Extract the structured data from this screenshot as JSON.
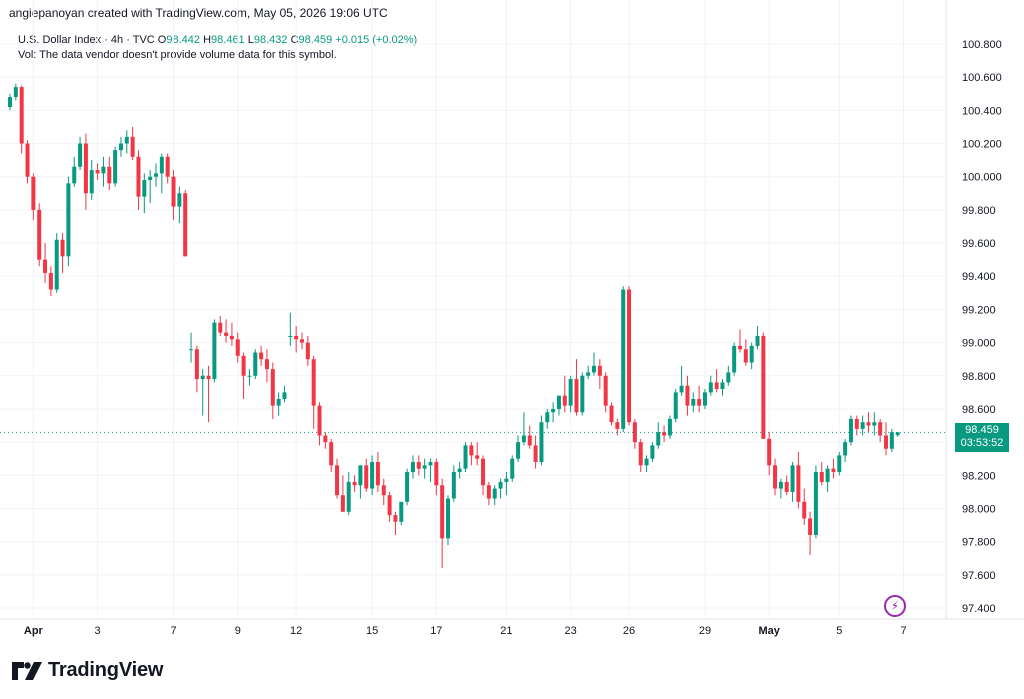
{
  "credit": "angiepanoyan created with TradingView.com, May 05, 2026 19:06 UTC",
  "legend": {
    "symbol": "U.S. Dollar Index · 4h · TVC",
    "o_label": "O",
    "o_value": "98.442",
    "h_label": "H",
    "h_value": "98.461",
    "l_label": "L",
    "l_value": "98.432",
    "c_label": "C",
    "c_value": "98.459",
    "change": "+0.015 (+0.02%)",
    "volume_note": "Vol: The data vendor doesn't provide volume data for this symbol."
  },
  "price_tag": {
    "price": "98.459",
    "countdown": "03:53:52"
  },
  "footer": {
    "logo_text": "TradingView"
  },
  "colors": {
    "up": "#089981",
    "down": "#f23645",
    "grid": "#f0f3fa",
    "text": "#131722",
    "accent_flash": "#9c27b0"
  },
  "icons": {
    "logo": "tradingview-logo-icon",
    "flash": "lightning-icon"
  },
  "chart_data": {
    "type": "candlestick",
    "ylim": [
      97.35,
      100.9
    ],
    "y_ticks": [
      "100.800",
      "100.600",
      "100.400",
      "100.200",
      "100.000",
      "99.800",
      "99.600",
      "99.400",
      "99.200",
      "99.000",
      "98.800",
      "98.600",
      "98.400",
      "98.200",
      "98.000",
      "97.800",
      "97.600",
      "97.400"
    ],
    "x_ticks": [
      {
        "label": "Apr",
        "bar": 4
      },
      {
        "label": "3",
        "bar": 15
      },
      {
        "label": "7",
        "bar": 28
      },
      {
        "label": "9",
        "bar": 39
      },
      {
        "label": "12",
        "bar": 49
      },
      {
        "label": "15",
        "bar": 62
      },
      {
        "label": "17",
        "bar": 73
      },
      {
        "label": "21",
        "bar": 85
      },
      {
        "label": "23",
        "bar": 96
      },
      {
        "label": "26",
        "bar": 106
      },
      {
        "label": "29",
        "bar": 119
      },
      {
        "label": "May",
        "bar": 130
      },
      {
        "label": "5",
        "bar": 142
      },
      {
        "label": "7",
        "bar": 153
      }
    ],
    "last_price": 98.459,
    "candles": [
      [
        100.42,
        100.5,
        100.4,
        100.48
      ],
      [
        100.48,
        100.56,
        100.46,
        100.54
      ],
      [
        100.54,
        100.55,
        100.14,
        100.2
      ],
      [
        100.2,
        100.22,
        99.96,
        100.0
      ],
      [
        100.0,
        100.02,
        99.74,
        99.8
      ],
      [
        99.8,
        99.84,
        99.46,
        99.5
      ],
      [
        99.5,
        99.6,
        99.36,
        99.42
      ],
      [
        99.42,
        99.46,
        99.28,
        99.32
      ],
      [
        99.32,
        99.66,
        99.3,
        99.62
      ],
      [
        99.62,
        99.66,
        99.42,
        99.52
      ],
      [
        99.52,
        100.0,
        99.46,
        99.96
      ],
      [
        99.96,
        100.12,
        99.94,
        100.06
      ],
      [
        100.06,
        100.24,
        100.04,
        100.2
      ],
      [
        100.2,
        100.26,
        99.8,
        99.9
      ],
      [
        99.9,
        100.1,
        99.86,
        100.04
      ],
      [
        100.04,
        100.08,
        99.98,
        100.02
      ],
      [
        100.02,
        100.12,
        99.94,
        100.06
      ],
      [
        100.06,
        100.12,
        99.92,
        99.96
      ],
      [
        99.96,
        100.18,
        99.94,
        100.16
      ],
      [
        100.16,
        100.24,
        100.12,
        100.2
      ],
      [
        100.2,
        100.28,
        100.14,
        100.24
      ],
      [
        100.24,
        100.3,
        100.1,
        100.12
      ],
      [
        100.12,
        100.16,
        99.8,
        99.88
      ],
      [
        99.88,
        100.02,
        99.78,
        99.98
      ],
      [
        99.98,
        100.04,
        99.84,
        100.0
      ],
      [
        100.0,
        100.08,
        99.94,
        100.02
      ],
      [
        100.02,
        100.14,
        99.9,
        100.12
      ],
      [
        100.12,
        100.14,
        99.96,
        100.0
      ],
      [
        100.0,
        100.04,
        99.74,
        99.82
      ],
      [
        99.82,
        99.94,
        99.72,
        99.9
      ],
      [
        99.9,
        99.92,
        99.52,
        99.52
      ],
      [
        98.96,
        99.06,
        98.88,
        98.96
      ],
      [
        98.96,
        98.98,
        98.7,
        98.78
      ],
      [
        98.78,
        98.84,
        98.56,
        98.8
      ],
      [
        98.8,
        98.86,
        98.52,
        98.78
      ],
      [
        98.78,
        99.14,
        98.76,
        99.12
      ],
      [
        99.12,
        99.16,
        99.04,
        99.06
      ],
      [
        99.06,
        99.14,
        99.0,
        99.04
      ],
      [
        99.04,
        99.12,
        98.98,
        99.02
      ],
      [
        99.02,
        99.06,
        98.88,
        98.92
      ],
      [
        98.92,
        98.94,
        98.66,
        98.8
      ],
      [
        98.8,
        98.84,
        98.74,
        98.8
      ],
      [
        98.8,
        98.96,
        98.78,
        98.94
      ],
      [
        98.94,
        98.98,
        98.86,
        98.9
      ],
      [
        98.9,
        98.96,
        98.76,
        98.84
      ],
      [
        98.84,
        98.88,
        98.54,
        98.62
      ],
      [
        98.62,
        98.7,
        98.56,
        98.66
      ],
      [
        98.66,
        98.74,
        98.64,
        98.7
      ],
      [
        99.04,
        99.18,
        98.98,
        99.04
      ],
      [
        99.04,
        99.1,
        98.94,
        99.02
      ],
      [
        99.02,
        99.06,
        98.96,
        99.0
      ],
      [
        99.0,
        99.04,
        98.86,
        98.9
      ],
      [
        98.9,
        98.92,
        98.48,
        98.62
      ],
      [
        98.62,
        98.64,
        98.38,
        98.44
      ],
      [
        98.44,
        98.46,
        98.36,
        98.4
      ],
      [
        98.4,
        98.42,
        98.22,
        98.26
      ],
      [
        98.26,
        98.3,
        98.06,
        98.08
      ],
      [
        98.08,
        98.2,
        97.98,
        97.98
      ],
      [
        97.98,
        98.22,
        97.96,
        98.16
      ],
      [
        98.16,
        98.2,
        98.1,
        98.14
      ],
      [
        98.14,
        98.26,
        98.06,
        98.26
      ],
      [
        98.26,
        98.3,
        98.1,
        98.12
      ],
      [
        98.12,
        98.32,
        98.08,
        98.28
      ],
      [
        98.28,
        98.34,
        98.1,
        98.14
      ],
      [
        98.14,
        98.18,
        98.02,
        98.08
      ],
      [
        98.08,
        98.1,
        97.92,
        97.96
      ],
      [
        97.96,
        97.98,
        97.84,
        97.92
      ],
      [
        97.92,
        98.02,
        97.9,
        98.04
      ],
      [
        98.04,
        98.24,
        98.02,
        98.22
      ],
      [
        98.22,
        98.32,
        98.18,
        98.28
      ],
      [
        98.28,
        98.32,
        98.2,
        98.24
      ],
      [
        98.24,
        98.3,
        98.18,
        98.26
      ],
      [
        98.26,
        98.3,
        98.16,
        98.28
      ],
      [
        98.28,
        98.3,
        98.08,
        98.14
      ],
      [
        98.14,
        98.18,
        97.64,
        97.82
      ],
      [
        97.82,
        98.08,
        97.78,
        98.06
      ],
      [
        98.06,
        98.26,
        98.04,
        98.22
      ],
      [
        98.22,
        98.28,
        98.18,
        98.24
      ],
      [
        98.24,
        98.4,
        98.22,
        98.38
      ],
      [
        98.38,
        98.4,
        98.26,
        98.32
      ],
      [
        98.32,
        98.4,
        98.26,
        98.3
      ],
      [
        98.3,
        98.32,
        98.08,
        98.14
      ],
      [
        98.14,
        98.16,
        98.02,
        98.06
      ],
      [
        98.06,
        98.14,
        98.02,
        98.12
      ],
      [
        98.12,
        98.18,
        98.06,
        98.16
      ],
      [
        98.16,
        98.22,
        98.08,
        98.18
      ],
      [
        98.18,
        98.32,
        98.16,
        98.3
      ],
      [
        98.3,
        98.44,
        98.28,
        98.4
      ],
      [
        98.4,
        98.58,
        98.38,
        98.44
      ],
      [
        98.44,
        98.5,
        98.36,
        98.38
      ],
      [
        98.38,
        98.44,
        98.24,
        98.28
      ],
      [
        98.28,
        98.56,
        98.26,
        98.52
      ],
      [
        98.52,
        98.6,
        98.48,
        98.58
      ],
      [
        98.58,
        98.64,
        98.52,
        98.6
      ],
      [
        98.6,
        98.68,
        98.56,
        98.68
      ],
      [
        98.68,
        98.8,
        98.58,
        98.62
      ],
      [
        98.62,
        98.8,
        98.58,
        98.78
      ],
      [
        98.78,
        98.9,
        98.56,
        98.58
      ],
      [
        98.58,
        98.82,
        98.56,
        98.8
      ],
      [
        98.8,
        98.86,
        98.78,
        98.82
      ],
      [
        98.82,
        98.94,
        98.8,
        98.86
      ],
      [
        98.86,
        98.9,
        98.72,
        98.8
      ],
      [
        98.8,
        98.82,
        98.58,
        98.62
      ],
      [
        98.62,
        98.64,
        98.5,
        98.52
      ],
      [
        98.52,
        98.54,
        98.44,
        98.48
      ],
      [
        98.48,
        99.34,
        98.46,
        99.32
      ],
      [
        99.32,
        99.34,
        98.5,
        98.52
      ],
      [
        98.52,
        98.54,
        98.36,
        98.4
      ],
      [
        98.4,
        98.42,
        98.22,
        98.26
      ],
      [
        98.26,
        98.32,
        98.22,
        98.3
      ],
      [
        98.3,
        98.4,
        98.28,
        98.38
      ],
      [
        98.38,
        98.52,
        98.36,
        98.46
      ],
      [
        98.46,
        98.5,
        98.4,
        98.44
      ],
      [
        98.44,
        98.56,
        98.42,
        98.54
      ],
      [
        98.54,
        98.72,
        98.52,
        98.7
      ],
      [
        98.7,
        98.86,
        98.68,
        98.74
      ],
      [
        98.74,
        98.8,
        98.56,
        98.62
      ],
      [
        98.62,
        98.7,
        98.58,
        98.66
      ],
      [
        98.66,
        98.74,
        98.58,
        98.62
      ],
      [
        98.62,
        98.72,
        98.6,
        98.7
      ],
      [
        98.7,
        98.8,
        98.68,
        98.76
      ],
      [
        98.76,
        98.84,
        98.7,
        98.72
      ],
      [
        98.72,
        98.78,
        98.68,
        98.76
      ],
      [
        98.76,
        98.86,
        98.74,
        98.82
      ],
      [
        98.82,
        99.0,
        98.8,
        98.98
      ],
      [
        98.98,
        99.08,
        98.94,
        98.96
      ],
      [
        98.96,
        99.02,
        98.86,
        98.88
      ],
      [
        98.88,
        99.0,
        98.84,
        98.98
      ],
      [
        98.98,
        99.1,
        98.96,
        99.04
      ],
      [
        99.04,
        99.06,
        98.42,
        98.42
      ],
      [
        98.42,
        98.46,
        98.2,
        98.26
      ],
      [
        98.26,
        98.3,
        98.08,
        98.12
      ],
      [
        98.12,
        98.18,
        98.06,
        98.16
      ],
      [
        98.16,
        98.2,
        98.08,
        98.1
      ],
      [
        98.1,
        98.28,
        98.04,
        98.26
      ],
      [
        98.26,
        98.34,
        98.0,
        98.04
      ],
      [
        98.04,
        98.12,
        97.9,
        97.94
      ],
      [
        97.94,
        97.98,
        97.72,
        97.84
      ],
      [
        97.84,
        98.26,
        97.82,
        98.22
      ],
      [
        98.22,
        98.28,
        98.14,
        98.16
      ],
      [
        98.16,
        98.26,
        98.1,
        98.24
      ],
      [
        98.24,
        98.3,
        98.18,
        98.22
      ],
      [
        98.22,
        98.34,
        98.2,
        98.32
      ],
      [
        98.32,
        98.42,
        98.28,
        98.4
      ],
      [
        98.4,
        98.56,
        98.38,
        98.54
      ],
      [
        98.54,
        98.56,
        98.44,
        98.48
      ],
      [
        98.48,
        98.56,
        98.44,
        98.52
      ],
      [
        98.52,
        98.58,
        98.46,
        98.5
      ],
      [
        98.5,
        98.58,
        98.44,
        98.52
      ],
      [
        98.52,
        98.54,
        98.4,
        98.44
      ],
      [
        98.44,
        98.52,
        98.32,
        98.36
      ],
      [
        98.36,
        98.48,
        98.34,
        98.46
      ],
      [
        98.442,
        98.461,
        98.432,
        98.459
      ]
    ]
  }
}
